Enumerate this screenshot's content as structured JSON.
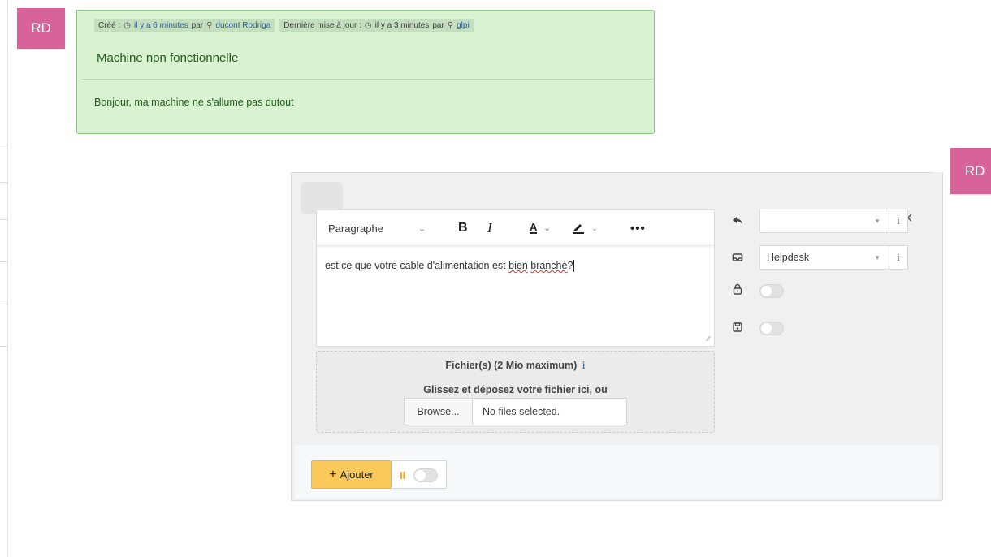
{
  "timeline": {
    "avatar_left": "RD",
    "avatar_right": "RD"
  },
  "followup": {
    "created_label": "Créé :",
    "created_time": "il y a 6 minutes",
    "created_by_word": "par",
    "created_user": "ducont Rodriga",
    "updated_label": "Dernière mise à jour :",
    "updated_time": "il y a 3 minutes",
    "updated_by_word": "par",
    "updated_user": "glpi",
    "title": "Machine non fonctionnelle",
    "body": "Bonjour, ma machine ne s'allume pas dutout"
  },
  "editor": {
    "paragraph_select": "Paragraphe",
    "bold_label": "B",
    "italic_label": "I",
    "color_label": "A",
    "more_label": "•••",
    "text_before": "est ce que votre cable d'alimentation est ",
    "text_misspelled_1": "bien",
    "text_space": " ",
    "text_misspelled_2": "branché",
    "text_after": "?"
  },
  "upload": {
    "title": "Fichier(s) (2 Mio maximum)",
    "info_icon": "i",
    "subtitle": "Glissez et déposez votre fichier ici, ou",
    "browse_label": "Browse...",
    "no_file_label": "No files selected."
  },
  "options": {
    "template_value": "",
    "source_value": "Helpdesk",
    "info_label": "i",
    "icons": [
      "reply-icon",
      "inbox-icon",
      "lock-icon",
      "save-icon"
    ]
  },
  "footer": {
    "add_plus": "+",
    "add_label": "Ajouter",
    "pause_icon": "II"
  },
  "close_label": "×"
}
